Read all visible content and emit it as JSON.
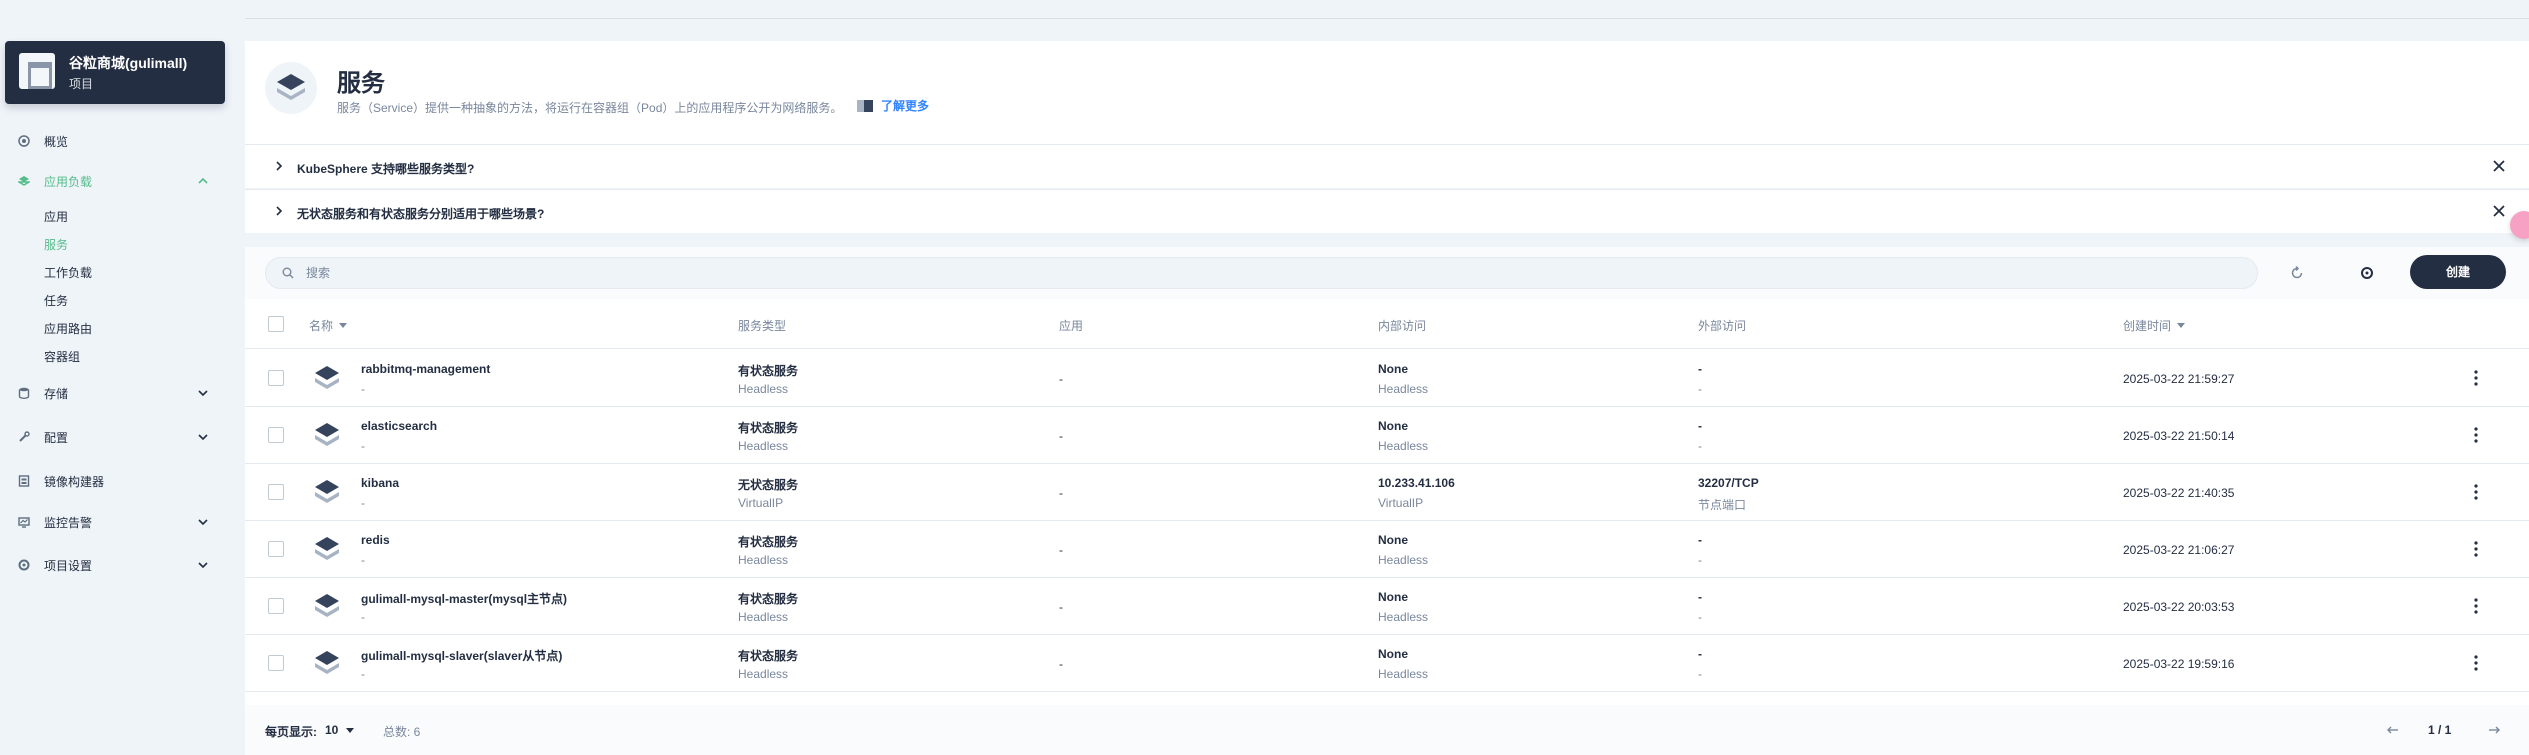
{
  "project": {
    "name": "谷粒商城(gulimall)",
    "type": "项目"
  },
  "nav": {
    "overview": "概览",
    "workloads": "应用负载",
    "workload_items": [
      "应用",
      "服务",
      "工作负载",
      "任务",
      "应用路由",
      "容器组"
    ],
    "storage": "存储",
    "config": "配置",
    "image_builder": "镜像构建器",
    "monitoring": "监控告警",
    "project_settings": "项目设置"
  },
  "header": {
    "title": "服务",
    "description": "服务（Service）提供一种抽象的方法，将运行在容器组（Pod）上的应用程序公开为网络服务。",
    "learn_more": "了解更多"
  },
  "faq": [
    "KubeSphere 支持哪些服务类型?",
    "无状态服务和有状态服务分别适用于哪些场景?"
  ],
  "toolbar": {
    "search_placeholder": "搜索",
    "create_label": "创建"
  },
  "columns": {
    "name": "名称",
    "service_type": "服务类型",
    "app": "应用",
    "internal_access": "内部访问",
    "external_access": "外部访问",
    "created_at": "创建时间"
  },
  "rows": [
    {
      "name": "rabbitmq-management",
      "desc": "-",
      "type": "有状态服务",
      "type_sub": "Headless",
      "app": "-",
      "internal": "None",
      "internal_sub": "Headless",
      "external": "-",
      "external_sub": "-",
      "created": "2025-03-22 21:59:27"
    },
    {
      "name": "elasticsearch",
      "desc": "-",
      "type": "有状态服务",
      "type_sub": "Headless",
      "app": "-",
      "internal": "None",
      "internal_sub": "Headless",
      "external": "-",
      "external_sub": "-",
      "created": "2025-03-22 21:50:14"
    },
    {
      "name": "kibana",
      "desc": "-",
      "type": "无状态服务",
      "type_sub": "VirtualIP",
      "app": "-",
      "internal": "10.233.41.106",
      "internal_sub": "VirtualIP",
      "external": "32207/TCP",
      "external_sub": "节点端口",
      "created": "2025-03-22 21:40:35"
    },
    {
      "name": "redis",
      "desc": "-",
      "type": "有状态服务",
      "type_sub": "Headless",
      "app": "-",
      "internal": "None",
      "internal_sub": "Headless",
      "external": "-",
      "external_sub": "-",
      "created": "2025-03-22 21:06:27"
    },
    {
      "name": "gulimall-mysql-master(mysql主节点)",
      "desc": "-",
      "type": "有状态服务",
      "type_sub": "Headless",
      "app": "-",
      "internal": "None",
      "internal_sub": "Headless",
      "external": "-",
      "external_sub": "-",
      "created": "2025-03-22 20:03:53"
    },
    {
      "name": "gulimall-mysql-slaver(slaver从节点)",
      "desc": "-",
      "type": "有状态服务",
      "type_sub": "Headless",
      "app": "-",
      "internal": "None",
      "internal_sub": "Headless",
      "external": "-",
      "external_sub": "-",
      "created": "2025-03-22 19:59:16"
    }
  ],
  "pagination": {
    "page_size_label": "每页显示:",
    "page_size": "10",
    "total_label": "总数: 6",
    "page_indicator": "1 / 1"
  },
  "colors": {
    "accent": "#55bc8a",
    "dark": "#242e42",
    "muted": "#79879c",
    "link": "#3385ff"
  }
}
